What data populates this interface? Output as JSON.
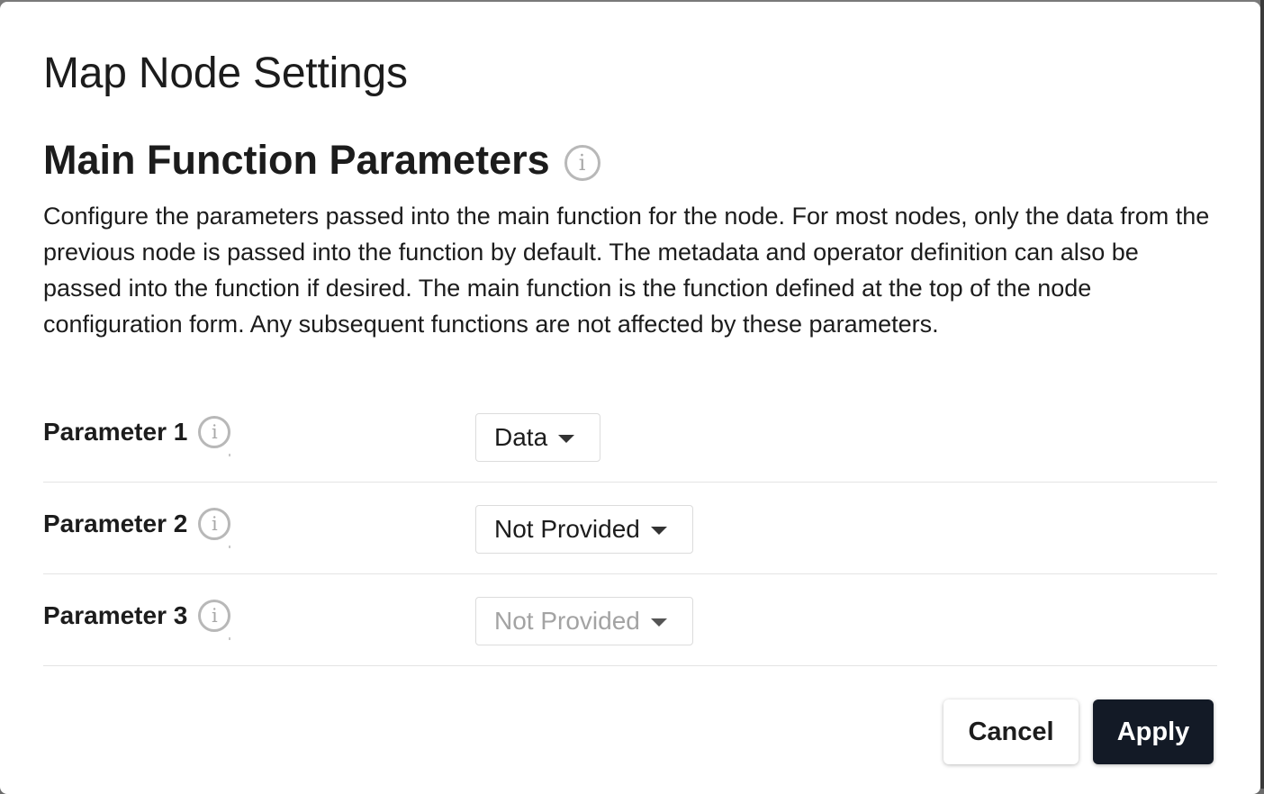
{
  "dialog": {
    "title": "Map Node Settings"
  },
  "section": {
    "heading": "Main Function Parameters",
    "info_icon": "info-icon",
    "description": "Configure the parameters passed into the main function for the node. For most nodes, only the data from the previous node is passed into the function by default. The metadata and operator definition can also be passed into the function if desired. The main function is the function defined at the top of the node configuration form. Any subsequent functions are not affected by these parameters."
  },
  "parameters": [
    {
      "label": "Parameter 1",
      "value": "Data",
      "disabled": false,
      "icon": "info-icon"
    },
    {
      "label": "Parameter 2",
      "value": "Not Provided",
      "disabled": false,
      "icon": "info-icon"
    },
    {
      "label": "Parameter 3",
      "value": "Not Provided",
      "disabled": true,
      "icon": "info-icon"
    }
  ],
  "footer": {
    "cancel_label": "Cancel",
    "apply_label": "Apply"
  },
  "colors": {
    "primary_button": "#131a26",
    "disabled_text": "#a3a3a3",
    "info_icon": "#b8b8b8"
  }
}
